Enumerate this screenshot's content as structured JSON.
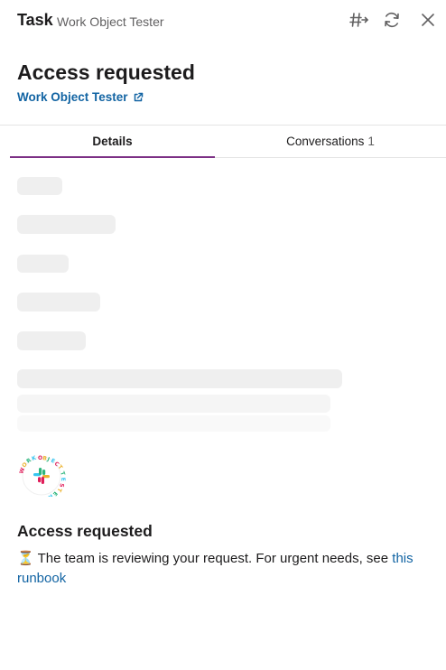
{
  "header": {
    "kind": "Task",
    "app_name": "Work Object Tester"
  },
  "object": {
    "title": "Access requested",
    "app_link": "Work Object Tester"
  },
  "tabs": [
    {
      "label": "Details",
      "selected": true
    },
    {
      "label": "Conversations",
      "count": "1",
      "selected": false
    }
  ],
  "message": {
    "title": "Access requested",
    "emoji": "⏳",
    "text": "The team is reviewing your request. For urgent needs, see ",
    "link_text": "this runbook"
  },
  "colors": {
    "accent": "#7c3085",
    "link": "#1264a3",
    "skeleton": "#efefef"
  },
  "icons": [
    "share-to-channel-icon",
    "refresh-icon",
    "close-icon",
    "external-link-icon",
    "hourglass-icon"
  ]
}
